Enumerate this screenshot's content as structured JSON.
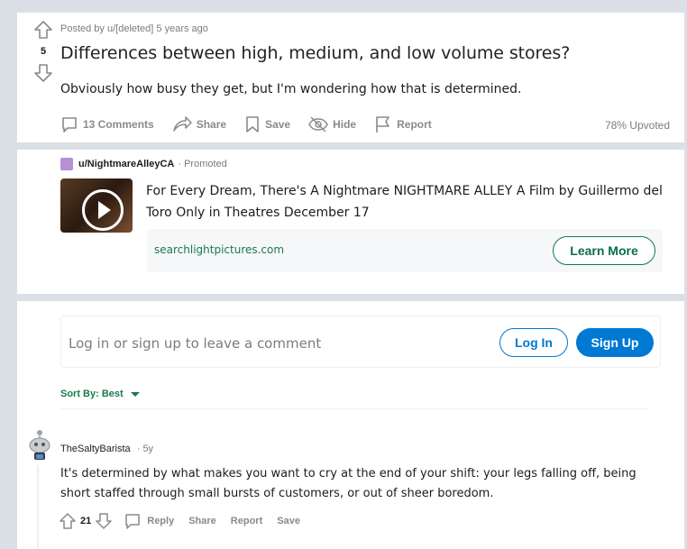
{
  "post": {
    "score": "5",
    "meta": "Posted by u/[deleted] 5 years ago",
    "title": "Differences between high, medium, and low volume stores?",
    "body": "Obviously how busy they get, but I'm wondering how that is determined.",
    "actions": {
      "comments": "13 Comments",
      "share": "Share",
      "save": "Save",
      "hide": "Hide",
      "report": "Report"
    },
    "upvoted": "78% Upvoted"
  },
  "ad": {
    "user": "u/NightmareAlleyCA",
    "promoted": "· Promoted",
    "text": "For Every Dream, There's A Nightmare NIGHTMARE ALLEY A Film by Guillermo del Toro Only in Theatres December 17",
    "domain": "searchlightpictures.com",
    "cta": "Learn More"
  },
  "login": {
    "prompt": "Log in or sign up to leave a comment",
    "login_label": "Log In",
    "signup_label": "Sign Up"
  },
  "sort": {
    "label": "Sort By: Best"
  },
  "comment": {
    "author": "TheSaltyBarista",
    "age": "· 5y",
    "body": "It's determined by what makes you want to cry at the end of your shift: your legs falling off, being short staffed through small bursts of customers, or out of sheer boredom.",
    "score": "21",
    "actions": {
      "reply": "Reply",
      "share": "Share",
      "report": "Report",
      "save": "Save"
    }
  },
  "colors": {
    "accent": "#0079d3",
    "sort_green": "#1a7a4c",
    "background": "#dae0e6"
  }
}
